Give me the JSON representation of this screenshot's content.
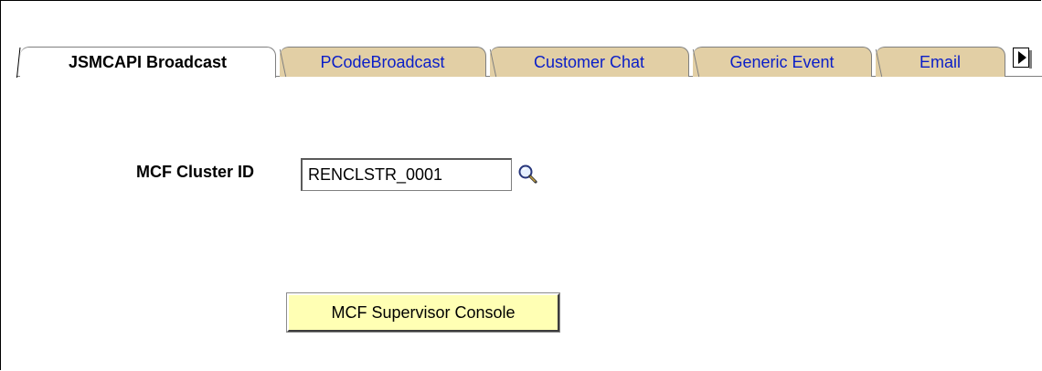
{
  "tabs": [
    {
      "label": "JSMCAPI Broadcast",
      "active": true
    },
    {
      "label": "PCodeBroadcast",
      "active": false
    },
    {
      "label": "Customer Chat",
      "active": false
    },
    {
      "label": "Generic Event",
      "active": false
    },
    {
      "label": "Email",
      "active": false
    }
  ],
  "tab_scroll": {
    "icon": "chevron-right-icon"
  },
  "form": {
    "cluster_label": "MCF Cluster ID",
    "cluster_value": "RENCLSTR_0001",
    "lookup_icon": "magnifier-lookup-icon"
  },
  "actions": {
    "console_button_label": "MCF Supervisor Console"
  },
  "colors": {
    "active_tab_text": "#000000",
    "inactive_tab_bg": "#e2cfa5",
    "inactive_tab_text": "#0a1ec8",
    "button_bg": "#ffffb4"
  }
}
